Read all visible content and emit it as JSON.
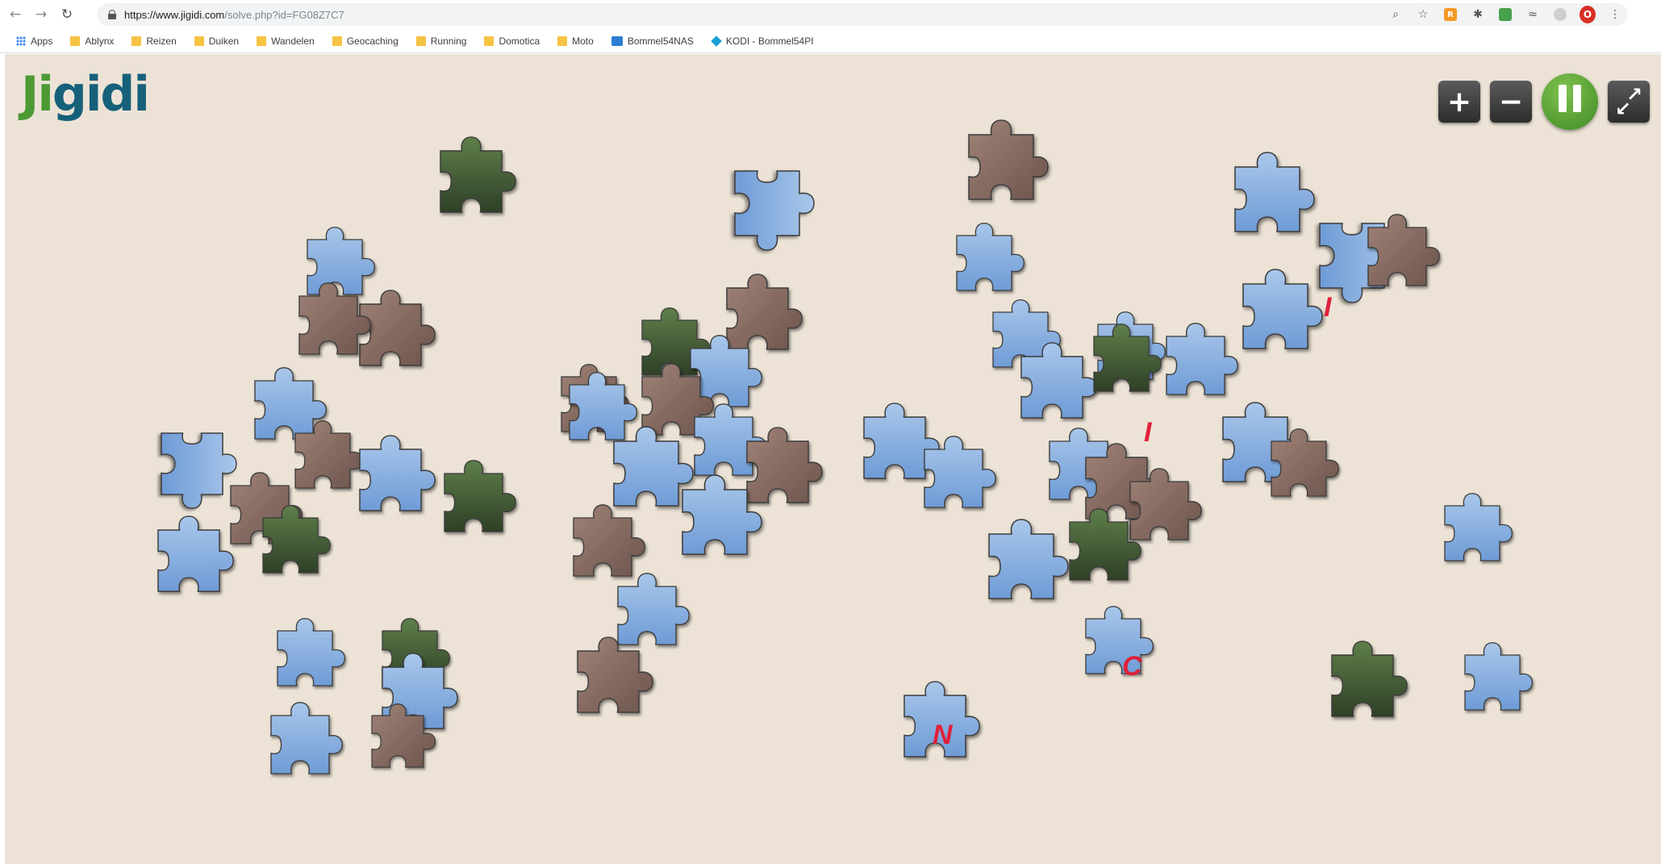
{
  "browser": {
    "url_base": "https://www.jigidi.com",
    "url_rest": "/solve.php?id=FG08Z7C7",
    "bookmarks": [
      "Apps",
      "Ablynx",
      "Reizen",
      "Duiken",
      "Wandelen",
      "Geocaching",
      "Running",
      "Domotica",
      "Moto",
      "Bommel54NAS",
      "KODI - Bommel54PI"
    ]
  },
  "game": {
    "logo_part1": "Ji",
    "logo_part2": "gidi",
    "zoom_in_label": "+",
    "zoom_out_label": "−"
  },
  "colors": {
    "sky": "#7fa9dc",
    "brick": "#8a6e63",
    "green": "#3d5a34",
    "letter_red": "#e0203a",
    "letter_blue": "#2a2fd8"
  },
  "visible_piece_letters": [
    "N",
    "C",
    "I",
    "I"
  ]
}
